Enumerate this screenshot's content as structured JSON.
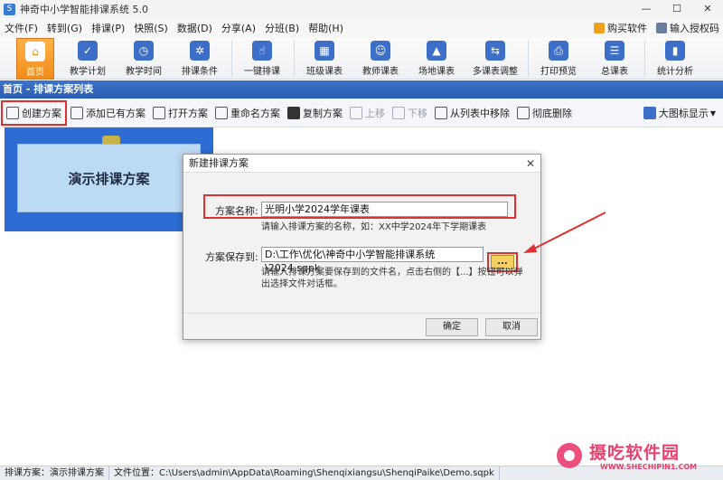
{
  "window": {
    "title": "神奇中小学智能排课系统 5.0",
    "app_icon": "S"
  },
  "menu": {
    "items": [
      "文件(F)",
      "转到(G)",
      "排课(P)",
      "快照(S)",
      "数据(D)",
      "分享(A)",
      "分班(B)",
      "帮助(H)"
    ],
    "buy": "购买软件",
    "license": "输入授权码"
  },
  "toolbar": {
    "items": [
      {
        "label": "首页",
        "icon": "home-icon",
        "glyph": "⌂"
      },
      {
        "label": "教学计划",
        "icon": "clipboard-icon",
        "glyph": "✓"
      },
      {
        "label": "教学时间",
        "icon": "clock-icon",
        "glyph": "◷"
      },
      {
        "label": "排课条件",
        "icon": "conditions-icon",
        "glyph": "✲"
      },
      {
        "label": "一键排课",
        "icon": "click-icon",
        "glyph": "☝"
      },
      {
        "label": "班级课表",
        "icon": "calendar-icon",
        "glyph": "▦"
      },
      {
        "label": "教师课表",
        "icon": "teacher-icon",
        "glyph": "☺"
      },
      {
        "label": "场地课表",
        "icon": "building-icon",
        "glyph": "▲"
      },
      {
        "label": "多课表调整",
        "icon": "adjust-icon",
        "glyph": "⇆"
      },
      {
        "label": "打印预览",
        "icon": "printer-icon",
        "glyph": "⎙"
      },
      {
        "label": "总课表",
        "icon": "total-icon",
        "glyph": "☰"
      },
      {
        "label": "统计分析",
        "icon": "chart-icon",
        "glyph": "▮"
      }
    ]
  },
  "breadcrumb": "首页 - 排课方案列表",
  "subtoolbar": {
    "create": "创建方案",
    "add_existing": "添加已有方案",
    "open": "打开方案",
    "rename": "重命名方案",
    "copy": "复制方案",
    "up": "上移",
    "down": "下移",
    "remove": "从列表中移除",
    "delete": "彻底删除",
    "view": "大图标显示"
  },
  "scheme_card": {
    "title": "演示排课方案"
  },
  "dialog": {
    "title": "新建排课方案",
    "name_label": "方案名称:",
    "name_value": "光明小学2024学年课表",
    "name_hint": "请输入排课方案的名称，如：XX中学2024年下学期课表",
    "path_label": "方案保存到:",
    "path_value": "D:\\工作\\优化\\神奇中小学智能排课系统\\2024.sqpk",
    "browse": "...",
    "path_hint_1": "请输入排课方案要保存到的文件名，点击右侧的【...】按钮可以弹",
    "path_hint_2": "出选择文件对话框。",
    "ok": "确定",
    "cancel": "取消"
  },
  "statusbar": {
    "scheme": "排课方案：演示排课方案",
    "location": "文件位置：C:\\Users\\admin\\AppData\\Roaming\\Shenqixiangsu\\ShenqiPaike\\Demo.sqpk"
  },
  "watermark": {
    "name": "摄吃软件园",
    "url": "WWW.SHECHIPIN1.COM"
  },
  "colors": {
    "accent_blue": "#2b5eb3",
    "highlight_red": "#e03030",
    "active_orange": "#f08c1a"
  }
}
